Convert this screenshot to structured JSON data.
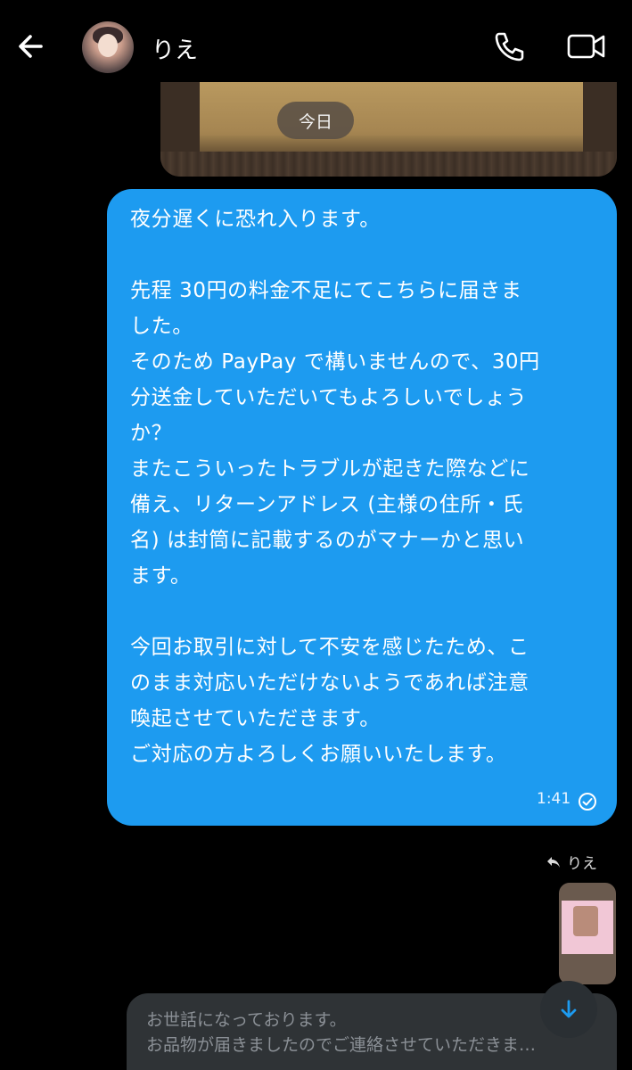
{
  "header": {
    "contact_name": "りえ"
  },
  "date_separator": "今日",
  "message": {
    "lines": [
      "夜分遅くに恐れ入ります。",
      "",
      "先程 30円の料金不足にてこちらに届きま",
      "した。",
      "そのため PayPay で構いませんので、30円",
      "分送金していただいてもよろしいでしょう",
      "か？",
      "またこういったトラブルが起きた際などに",
      "備え、リターンアドレス (主様の住所・氏",
      "名) は封筒に記載するのがマナーかと思い",
      "ます。",
      "",
      "今回お取引に対して不安を感じたため、こ",
      "のまま対応いただけないようであれば注意",
      "喚起させていただきます。",
      "ご対応の方よろしくお願いいたします。"
    ],
    "time": "1:41",
    "status_icon": "read-check-icon",
    "bubble_color": "#1d9bf0"
  },
  "reply": {
    "name": "りえ",
    "icon": "reply-arrow-icon"
  },
  "composer": {
    "lines": [
      "お世話になっております。",
      "お品物が届きましたのでご連絡させていただきま…"
    ]
  },
  "colors": {
    "background": "#000000",
    "composer_bg": "#2f3336",
    "accent": "#1d9bf0"
  }
}
